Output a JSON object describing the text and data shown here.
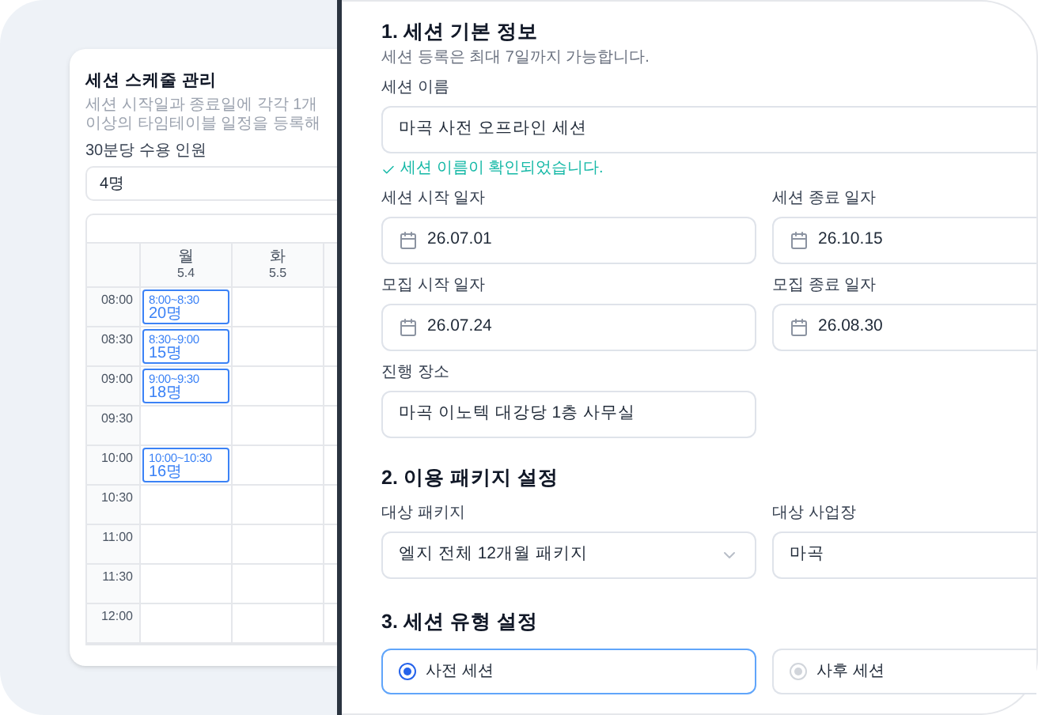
{
  "schedule_panel": {
    "title": "세션 스케줄 관리",
    "description": "세션 시작일과 종료일에 각각 1개 이상의 타임테이블 일정을 등록해",
    "capacity_label": "30분당 수용 인원",
    "capacity_value": "4명",
    "days": [
      {
        "weekday": "월",
        "date": "5.4"
      },
      {
        "weekday": "화",
        "date": "5.5"
      }
    ],
    "rows": [
      {
        "time": "08:00",
        "slot": {
          "range": "8:00~8:30",
          "count": "20명"
        }
      },
      {
        "time": "08:30",
        "slot": {
          "range": "8:30~9:00",
          "count": "15명"
        }
      },
      {
        "time": "09:00",
        "slot": {
          "range": "9:00~9:30",
          "count": "18명"
        }
      },
      {
        "time": "09:30"
      },
      {
        "time": "10:00",
        "slot": {
          "range": "10:00~10:30",
          "count": "16명"
        }
      },
      {
        "time": "10:30"
      },
      {
        "time": "11:00"
      },
      {
        "time": "11:30"
      },
      {
        "time": "12:00"
      }
    ]
  },
  "form": {
    "basic": {
      "title": "1. 세션 기본 정보",
      "note": "세션 등록은 최대 7일까지 가능합니다.",
      "name_field": {
        "label": "세션 이름",
        "value": "마곡 사전 오프라인 세션",
        "validation": "세션 이름이 확인되었습니다."
      },
      "date_fields": [
        {
          "label": "세션 시작 일자",
          "value": "26.07.01"
        },
        {
          "label": "세션 종료 일자",
          "value": "26.10.15"
        },
        {
          "label": "모집 시작 일자",
          "value": "26.07.24"
        },
        {
          "label": "모집 종료 일자",
          "value": "26.08.30"
        }
      ],
      "venue": {
        "label": "진행 장소",
        "value": "마곡 이노텍 대강당 1층 사무실"
      }
    },
    "package": {
      "title": "2. 이용 패키지 설정",
      "package_field": {
        "label": "대상 패키지",
        "value": "엘지 전체 12개월 패키지"
      },
      "site_field": {
        "label": "대상 사업장",
        "value": "마곡"
      }
    },
    "session_type": {
      "title": "3. 세션 유형 설정",
      "options": [
        {
          "label": "사전 세션",
          "selected": true
        },
        {
          "label": "사후 세션",
          "selected": false
        }
      ]
    }
  }
}
